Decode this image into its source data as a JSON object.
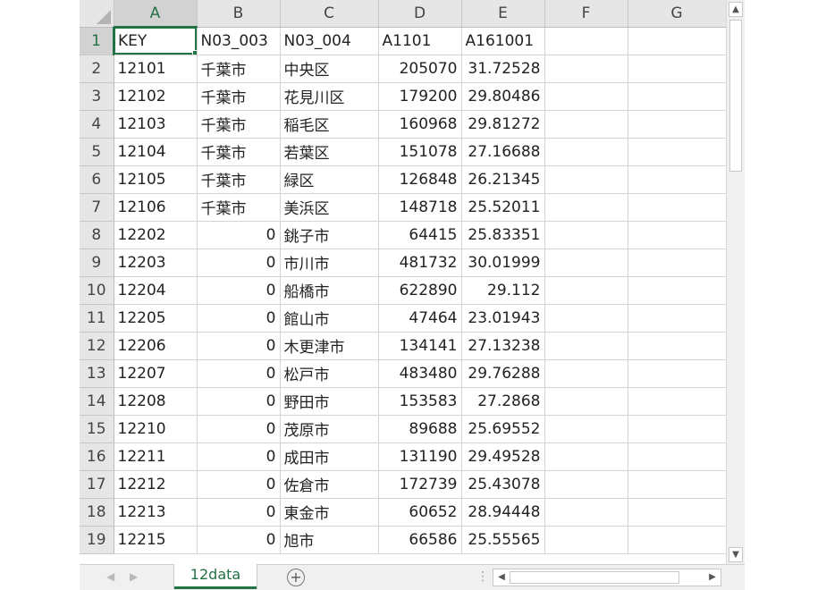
{
  "columns": [
    "A",
    "B",
    "C",
    "D",
    "E",
    "F",
    "G"
  ],
  "header_row": {
    "row": "1",
    "cells": [
      "KEY",
      "N03_003",
      "N03_004",
      "A1101",
      "A161001",
      "",
      ""
    ]
  },
  "rows": [
    {
      "row": "2",
      "cells": [
        "12101",
        "千葉市",
        "中央区",
        "205070",
        "31.72528"
      ]
    },
    {
      "row": "3",
      "cells": [
        "12102",
        "千葉市",
        "花見川区",
        "179200",
        "29.80486"
      ]
    },
    {
      "row": "4",
      "cells": [
        "12103",
        "千葉市",
        "稲毛区",
        "160968",
        "29.81272"
      ]
    },
    {
      "row": "5",
      "cells": [
        "12104",
        "千葉市",
        "若葉区",
        "151078",
        "27.16688"
      ]
    },
    {
      "row": "6",
      "cells": [
        "12105",
        "千葉市",
        "緑区",
        "126848",
        "26.21345"
      ]
    },
    {
      "row": "7",
      "cells": [
        "12106",
        "千葉市",
        "美浜区",
        "148718",
        "25.52011"
      ]
    },
    {
      "row": "8",
      "cells": [
        "12202",
        "0",
        "銚子市",
        "64415",
        "25.83351"
      ]
    },
    {
      "row": "9",
      "cells": [
        "12203",
        "0",
        "市川市",
        "481732",
        "30.01999"
      ]
    },
    {
      "row": "10",
      "cells": [
        "12204",
        "0",
        "船橋市",
        "622890",
        "29.112"
      ]
    },
    {
      "row": "11",
      "cells": [
        "12205",
        "0",
        "館山市",
        "47464",
        "23.01943"
      ]
    },
    {
      "row": "12",
      "cells": [
        "12206",
        "0",
        "木更津市",
        "134141",
        "27.13238"
      ]
    },
    {
      "row": "13",
      "cells": [
        "12207",
        "0",
        "松戸市",
        "483480",
        "29.76288"
      ]
    },
    {
      "row": "14",
      "cells": [
        "12208",
        "0",
        "野田市",
        "153583",
        "27.2868"
      ]
    },
    {
      "row": "15",
      "cells": [
        "12210",
        "0",
        "茂原市",
        "89688",
        "25.69552"
      ]
    },
    {
      "row": "16",
      "cells": [
        "12211",
        "0",
        "成田市",
        "131190",
        "29.49528"
      ]
    },
    {
      "row": "17",
      "cells": [
        "12212",
        "0",
        "佐倉市",
        "172739",
        "25.43078"
      ]
    },
    {
      "row": "18",
      "cells": [
        "12213",
        "0",
        "東金市",
        "60652",
        "28.94448"
      ]
    },
    {
      "row": "19",
      "cells": [
        "12215",
        "0",
        "旭市",
        "66586",
        "25.55565"
      ]
    }
  ],
  "sheet_tab": {
    "label": "12data"
  },
  "colors": {
    "accent": "#217346",
    "header_bg": "#e6e6e6",
    "gridline": "#d4d4d4"
  },
  "icons": {
    "select_all": "triangle-corner-icon",
    "add_sheet": "plus-circle-icon",
    "scroll_up": "arrow-up-icon",
    "scroll_down": "arrow-down-icon",
    "scroll_left": "arrow-left-icon",
    "scroll_right": "arrow-right-icon"
  }
}
